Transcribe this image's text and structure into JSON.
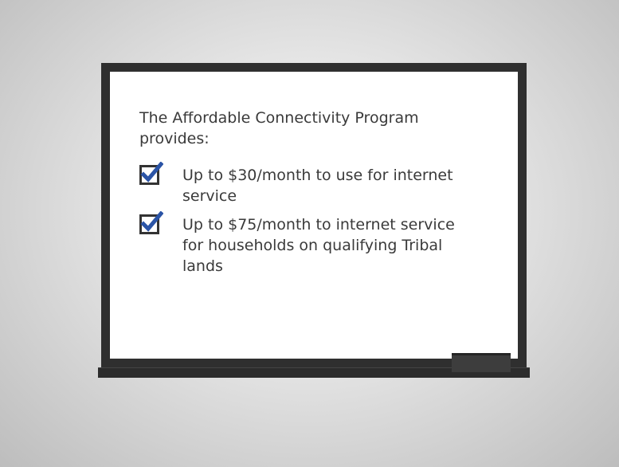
{
  "whiteboard": {
    "heading": "The Affordable Connectivity Program provides:",
    "items": [
      {
        "text": "Up to $30/month to use for internet service",
        "checked": true
      },
      {
        "text": "Up to $75/month to internet service for households on qualifying Tribal lands",
        "checked": true
      }
    ]
  },
  "colors": {
    "frame": "#2f2f2f",
    "checkmark": "#2b54a6",
    "text": "#3a3a3a"
  }
}
